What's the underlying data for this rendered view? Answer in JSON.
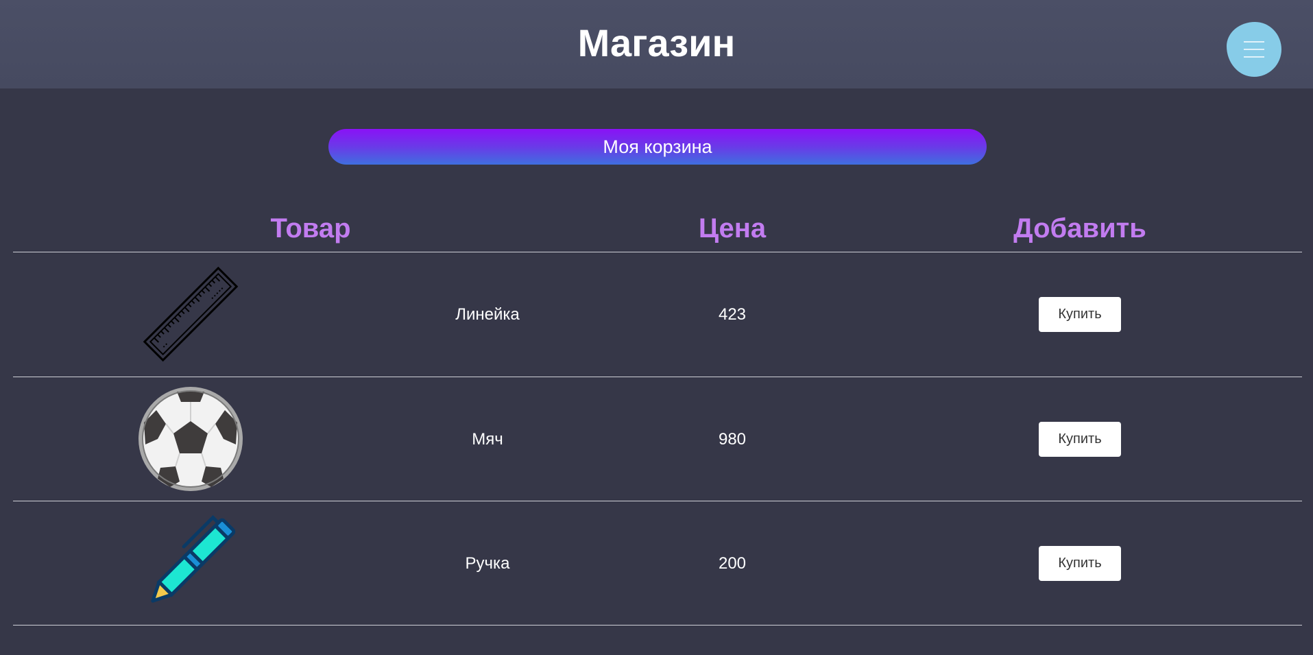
{
  "header": {
    "title": "Магазин",
    "menu_icon": "hamburger-menu-icon"
  },
  "cart": {
    "label": "Моя корзина"
  },
  "table": {
    "columns": [
      "Товар",
      "Цена",
      "Добавить"
    ],
    "rows": [
      {
        "icon": "ruler-icon",
        "name": "Линейка",
        "price": "423",
        "action": "Купить"
      },
      {
        "icon": "soccer-ball-icon",
        "name": "Мяч",
        "price": "980",
        "action": "Купить"
      },
      {
        "icon": "pen-icon",
        "name": "Ручка",
        "price": "200",
        "action": "Купить"
      }
    ]
  },
  "colors": {
    "background": "#363748",
    "header": "#4b4f66",
    "column_heading": "#c27cf0",
    "menu_button": "#87cce8",
    "cart_gradient_top": "#8a12f6",
    "cart_gradient_bottom": "#3f6fdf"
  }
}
